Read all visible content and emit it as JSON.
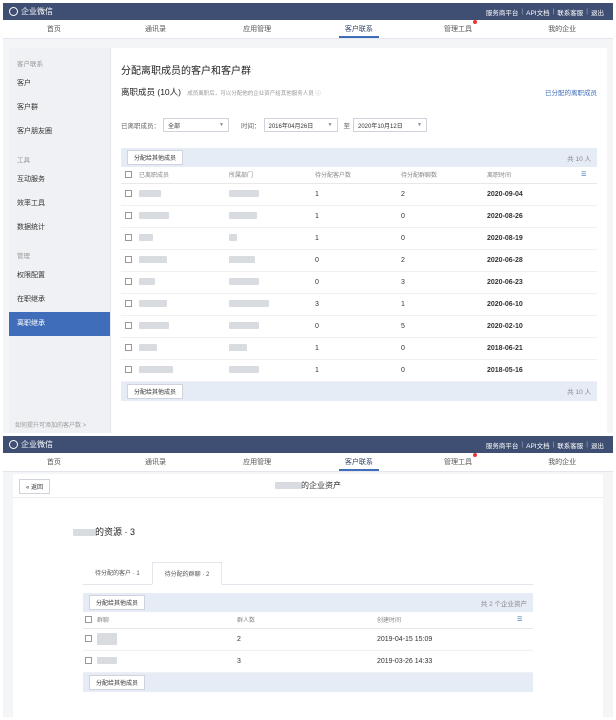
{
  "brand": "企业微信",
  "top_links": [
    "服务商平台",
    "API文档",
    "联系客服",
    "退出"
  ],
  "nav": [
    {
      "label": "首页"
    },
    {
      "label": "通讯录"
    },
    {
      "label": "应用管理"
    },
    {
      "label": "客户联系",
      "active": true
    },
    {
      "label": "管理工具",
      "dot": true
    },
    {
      "label": "我的企业"
    }
  ],
  "sidebar": {
    "groups": [
      {
        "label": "客户联系",
        "items": [
          "客户",
          "客户群",
          "客户朋友圈"
        ]
      },
      {
        "label": "工具",
        "items": [
          "互动服务",
          "效率工具",
          "数据统计"
        ]
      },
      {
        "label": "管理",
        "items": [
          "权限配置",
          "在职继承",
          "离职继承"
        ]
      }
    ],
    "active_item": "离职继承",
    "bottom_link": "如何提升可添加的客户数 >"
  },
  "screen1": {
    "page_title": "分配离职成员的客户和客户群",
    "section_title": "离职成员 (10人)",
    "section_hint": "成员离职后，可以分配他的企业资产给其他服务人员 ⓘ",
    "assigned_link": "已分配的离职成员",
    "filter": {
      "member_label": "已离职成员：",
      "member_value": "全部",
      "time_label": "时间：",
      "date_from": "2016年04月26日",
      "to_label": "至",
      "date_to": "2020年10月12日"
    },
    "assign_button": "分配给其他成员",
    "count": "共 10 人",
    "columns": [
      "已离职成员",
      "所属部门",
      "待分配客户数",
      "待分配群聊数",
      "离职时间"
    ],
    "rows": [
      {
        "customers": "1",
        "groups": "2",
        "date": "2020-09-04"
      },
      {
        "customers": "1",
        "groups": "0",
        "date": "2020-08-26"
      },
      {
        "customers": "1",
        "groups": "0",
        "date": "2020-08-19"
      },
      {
        "customers": "0",
        "groups": "2",
        "date": "2020-06-28"
      },
      {
        "customers": "0",
        "groups": "3",
        "date": "2020-06-23"
      },
      {
        "customers": "3",
        "groups": "1",
        "date": "2020-06-10"
      },
      {
        "customers": "0",
        "groups": "5",
        "date": "2020-02-10"
      },
      {
        "customers": "1",
        "groups": "0",
        "date": "2018-06-21"
      },
      {
        "customers": "1",
        "groups": "0",
        "date": "2018-05-16"
      }
    ]
  },
  "screen2": {
    "back_label": "« 返回",
    "asset_title": "的企业资产",
    "resource_title": "的资源 · 3",
    "tabs": [
      {
        "label": "待分配的客户 · 1"
      },
      {
        "label": "待分配的群聊 · 2",
        "active": true
      }
    ],
    "assign_button": "分配给其他成员",
    "count": "共 2 个企业资产",
    "columns": [
      "群聊",
      "群人数",
      "创建时间"
    ],
    "rows": [
      {
        "members": "2",
        "created": "2019-04-15 15:09"
      },
      {
        "members": "3",
        "created": "2019-03-26 14:33"
      }
    ]
  },
  "colors": {
    "topbar": "#3f4f73",
    "accent": "#3f6dba",
    "bar": "#e6ecf5"
  }
}
